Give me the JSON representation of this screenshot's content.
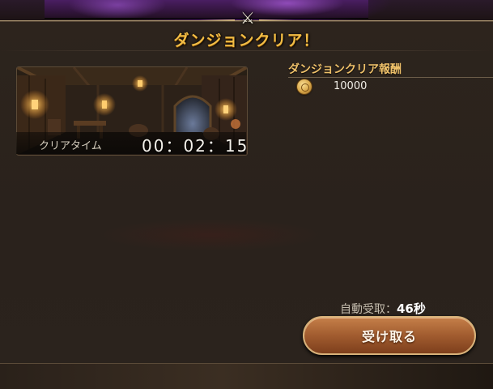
{
  "title": "ダンジョンクリア！",
  "clear_time": {
    "label": "クリアタイム",
    "value": "00：02：15"
  },
  "rewards": {
    "title": "ダンジョンクリア報酬",
    "items": [
      {
        "icon": "gold-coin-icon",
        "amount": "10000"
      }
    ]
  },
  "auto_receive": {
    "label": "自動受取：",
    "value": "46秒"
  },
  "accept_button": {
    "label": "受け取る"
  },
  "colors": {
    "title": "#f1bc45",
    "section_title": "#efc16a",
    "button": "#a15c2f",
    "panel": "#2a221c"
  }
}
